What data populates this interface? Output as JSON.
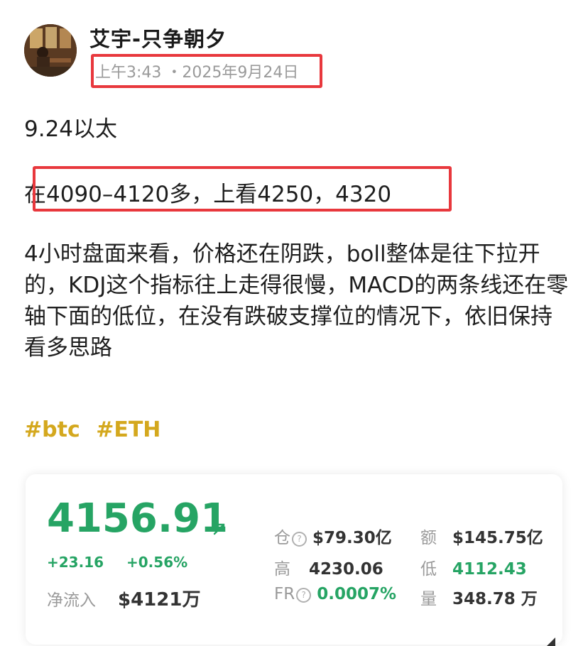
{
  "post": {
    "author": "艾宇-只争朝夕",
    "time": "上午3:43 ・2025年9月24日",
    "title_line": "9.24以太",
    "entry_line": "在4090–4120多，上看4250，4320",
    "analysis": "4小时盘面来看，价格还在阴跌，boll整体是往下拉开的，KDJ这个指标往上走得很慢，MACD的两条线还在零轴下面的低位，在没有跌破支撑位的情况下，依旧保持看多思路",
    "tags": [
      "#btc",
      "#ETH"
    ]
  },
  "ticker": {
    "price": "4156.91",
    "change_abs": "+23.16",
    "change_pct": "+0.56%",
    "inflow_label": "净流入",
    "inflow_value": "$4121万",
    "stats": {
      "oi_label": "仓",
      "oi_value": "$79.30亿",
      "volume_amount_label": "额",
      "volume_amount_value": "$145.75亿",
      "high_label": "高",
      "high_value": "4230.06",
      "low_label": "低",
      "low_value": "4112.43",
      "fr_label": "FR",
      "fr_value": "0.0007%",
      "qty_label": "量",
      "qty_value": "348.78 万"
    },
    "colors": {
      "up": "#26a464",
      "tag": "#d4a81e",
      "highlight": "#e8383d"
    }
  }
}
